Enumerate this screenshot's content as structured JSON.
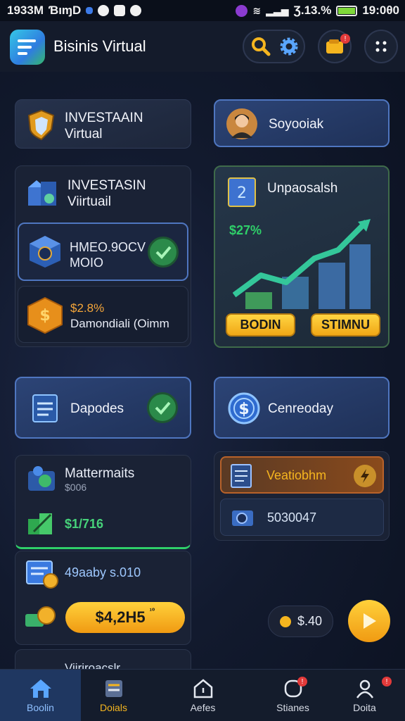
{
  "status_bar": {
    "time_left": "1933M",
    "carrier": "ƁıɱD",
    "battery_text": "Ʒ.13.%",
    "clock": "19:0θ0"
  },
  "app": {
    "title": "Bisinis Virtual"
  },
  "cards": {
    "invest_top": {
      "line1": "INVESTAAIN",
      "line2": "Virtual"
    },
    "profile": {
      "name": "Soyooiak"
    },
    "invest_panel": {
      "line1": "INVESTASIN",
      "line2": "Viirtuail"
    },
    "hmeo": {
      "line1": "HMEO.9OCV",
      "line2": "MOIO"
    },
    "diamond": {
      "amount": "$2.8%",
      "label": "Damondiali (Oimm"
    },
    "chart_card": {
      "title": "Unpaosalsh",
      "percent": "$27%",
      "btn_left": "BODIN",
      "btn_right": "STIMNU"
    },
    "deposits": {
      "label": "Dapodes"
    },
    "currency": {
      "label": "Cenreoday"
    },
    "materials": {
      "title": "Mattermaits",
      "sub": "$006",
      "amount": "$1/716"
    },
    "stats_row": {
      "text": "49aaby s.010"
    },
    "big_button": {
      "label": "$4,2H5",
      "sup": "¹⁰"
    },
    "vendor": {
      "label": "Veatiobhm"
    },
    "code": {
      "label": "5030047"
    },
    "balance": {
      "label": "$.40"
    },
    "partial": {
      "label": "Viiriroacslr"
    }
  },
  "nav": [
    {
      "label": "Boolin"
    },
    {
      "label": "Doials"
    },
    {
      "label": "Aefes"
    },
    {
      "label": "Stianes"
    },
    {
      "label": "Doita"
    }
  ],
  "colors": {
    "accent_gold": "#f5b51f",
    "accent_green": "#2fcf69",
    "accent_blue": "#4f76c0",
    "nav_active": "#1f3761"
  }
}
